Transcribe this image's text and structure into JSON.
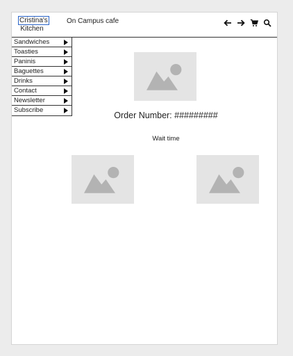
{
  "header": {
    "logo_line1": "Cristina's",
    "logo_line2": "Kitchen",
    "subtitle": "On Campus cafe",
    "icons": [
      "arrow-left-icon",
      "arrow-right-icon",
      "cart-icon",
      "search-icon"
    ]
  },
  "menu": {
    "items": [
      {
        "label": "Sandwiches"
      },
      {
        "label": "Toasties"
      },
      {
        "label": "Paninis"
      },
      {
        "label": "Baguettes"
      },
      {
        "label": "Drinks"
      },
      {
        "label": "Contact"
      },
      {
        "label": "Newsletter"
      },
      {
        "label": "Subscribe"
      }
    ]
  },
  "main": {
    "order_text": "Order Number: #########",
    "wait_text": "Wait time"
  },
  "colors": {
    "placeholder_bg": "#e4e4e4",
    "placeholder_fg": "#b3b3b3",
    "logo_border": "#2a64c8"
  }
}
